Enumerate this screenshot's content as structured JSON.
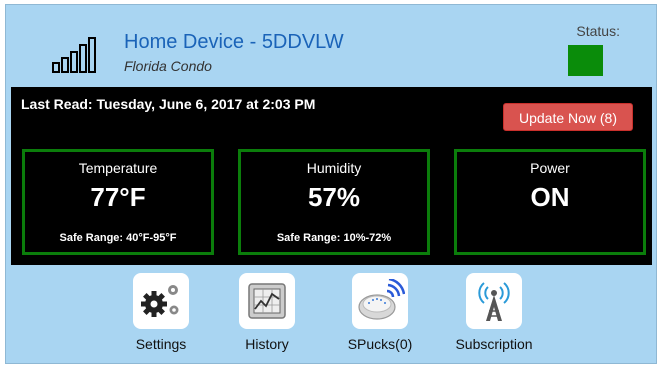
{
  "device": {
    "title": "Home Device - 5DDVLW",
    "subtitle": "Florida Condo",
    "signal_icon": "signal-bars-icon"
  },
  "status": {
    "label": "Status:",
    "color": "#0a8c0a"
  },
  "panel": {
    "last_read": "Last Read: Tuesday, June 6, 2017 at 2:03 PM",
    "update_button": "Update Now (8)",
    "update_color": "#d9534f",
    "tiles": [
      {
        "label": "Temperature",
        "value": "77°F",
        "range": "Safe Range: 40°F-95°F"
      },
      {
        "label": "Humidity",
        "value": "57%",
        "range": "Safe Range: 10%-72%"
      },
      {
        "label": "Power",
        "value": "ON",
        "range": ""
      }
    ],
    "tile_border_color": "#0b7d0b"
  },
  "nav": {
    "items": [
      {
        "label": "Settings",
        "icon": "gears-icon"
      },
      {
        "label": "History",
        "icon": "chart-icon"
      },
      {
        "label": "SPucks(0)",
        "icon": "spuck-icon"
      },
      {
        "label": "Subscription",
        "icon": "antenna-icon"
      }
    ]
  }
}
